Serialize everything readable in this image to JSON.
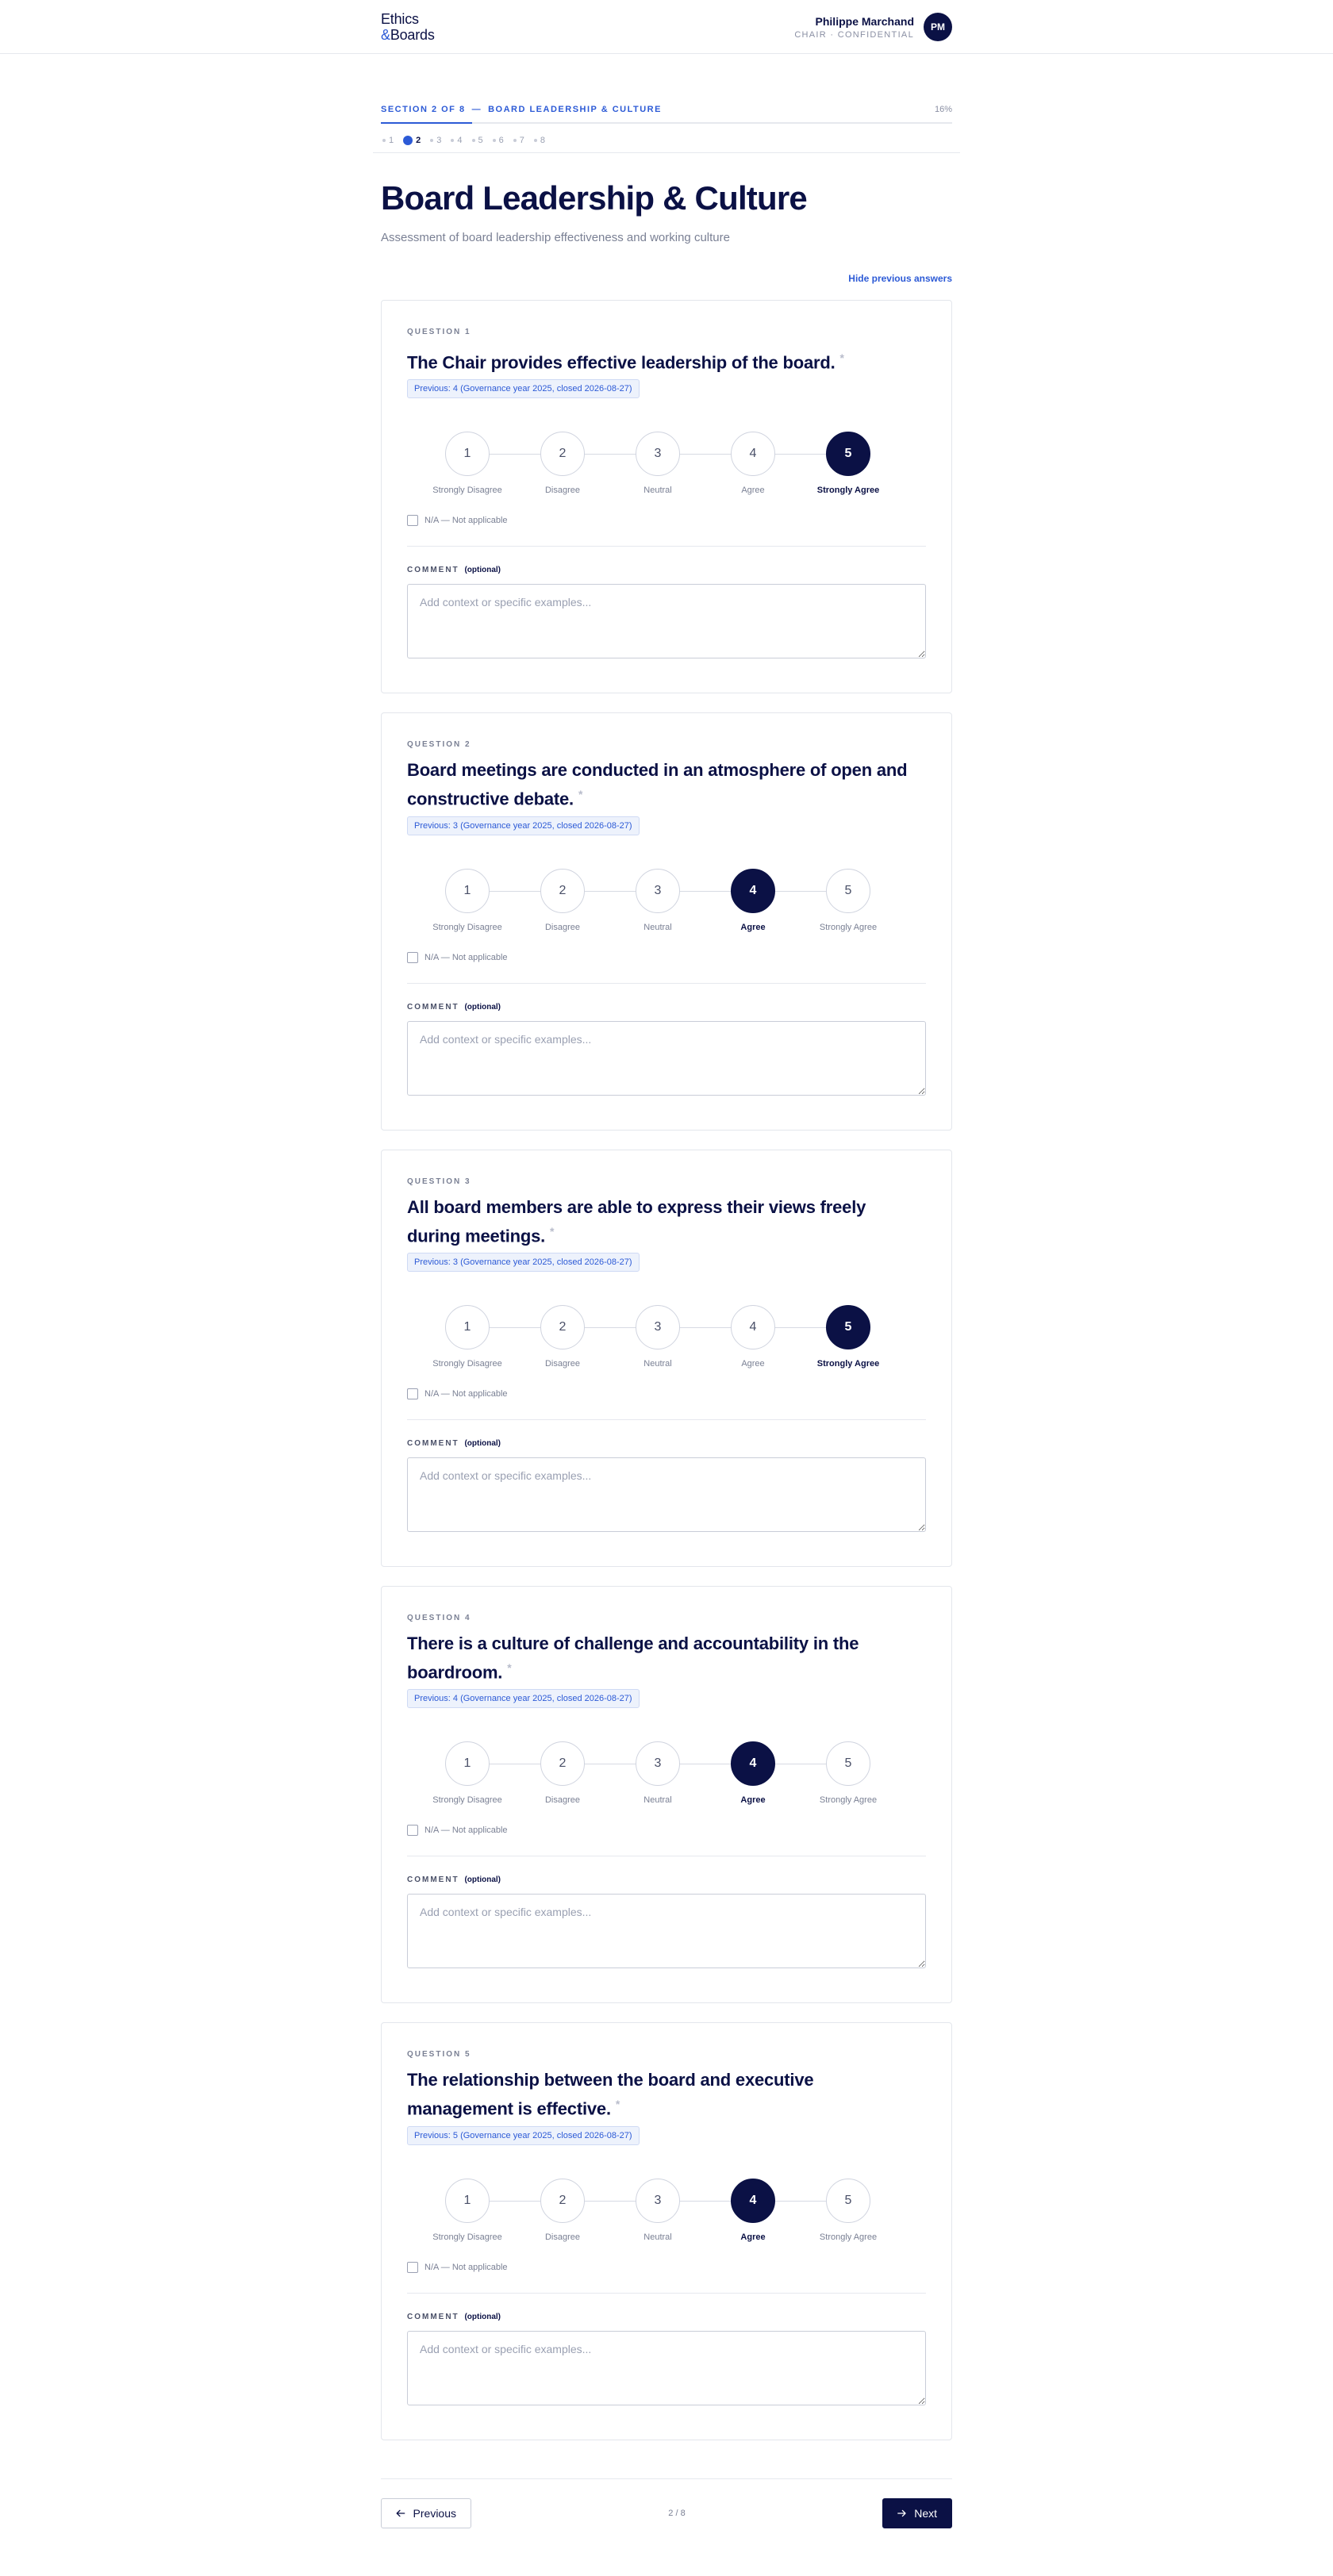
{
  "brand": {
    "line1": "Ethics",
    "amp": "&",
    "line2": "Boards"
  },
  "user": {
    "name": "Philippe Marchand",
    "role": "CHAIR · CONFIDENTIAL",
    "initials": "PM"
  },
  "section": {
    "label": "SECTION 2 OF 8",
    "separator": "—",
    "name": "BOARD LEADERSHIP & CULTURE",
    "percent_text": "16%",
    "progress": 0.16,
    "steps": [
      {
        "label": "1",
        "active": false
      },
      {
        "label": "2",
        "active": true
      },
      {
        "label": "3",
        "active": false
      },
      {
        "label": "4",
        "active": false
      },
      {
        "label": "5",
        "active": false
      },
      {
        "label": "6",
        "active": false
      },
      {
        "label": "7",
        "active": false
      },
      {
        "label": "8",
        "active": false
      }
    ]
  },
  "page": {
    "title": "Board Leadership & Culture",
    "subtitle": "Assessment of board leadership effectiveness and working culture",
    "toggle_previous": "Hide previous answers"
  },
  "scale_options": [
    {
      "value": "1",
      "label": "Strongly Disagree"
    },
    {
      "value": "2",
      "label": "Disagree"
    },
    {
      "value": "3",
      "label": "Neutral"
    },
    {
      "value": "4",
      "label": "Agree"
    },
    {
      "value": "5",
      "label": "Strongly Agree"
    }
  ],
  "labels": {
    "required_mark": "*",
    "na": "N/A — Not applicable",
    "comment": "COMMENT",
    "comment_optional": "(optional)",
    "comment_placeholder": "Add context or specific examples..."
  },
  "questions": [
    {
      "eyebrow": "QUESTION 1",
      "text": "The Chair provides effective leadership of the board.",
      "previous": "Previous: 4 (Governance year 2025, closed 2026-08-27)",
      "selected": 5,
      "comment": ""
    },
    {
      "eyebrow": "QUESTION 2",
      "text": "Board meetings are conducted in an atmosphere of open and constructive debate.",
      "previous": "Previous: 3 (Governance year 2025, closed 2026-08-27)",
      "selected": 4,
      "comment": ""
    },
    {
      "eyebrow": "QUESTION 3",
      "text": "All board members are able to express their views freely during meetings.",
      "previous": "Previous: 3 (Governance year 2025, closed 2026-08-27)",
      "selected": 5,
      "comment": ""
    },
    {
      "eyebrow": "QUESTION 4",
      "text": "There is a culture of challenge and accountability in the boardroom.",
      "previous": "Previous: 4 (Governance year 2025, closed 2026-08-27)",
      "selected": 4,
      "comment": ""
    },
    {
      "eyebrow": "QUESTION 5",
      "text": "The relationship between the board and executive management is effective.",
      "previous": "Previous: 5 (Governance year 2025, closed 2026-08-27)",
      "selected": 4,
      "comment": ""
    }
  ],
  "footer": {
    "previous": "Previous",
    "page_count": "2 / 8",
    "next": "Next"
  }
}
